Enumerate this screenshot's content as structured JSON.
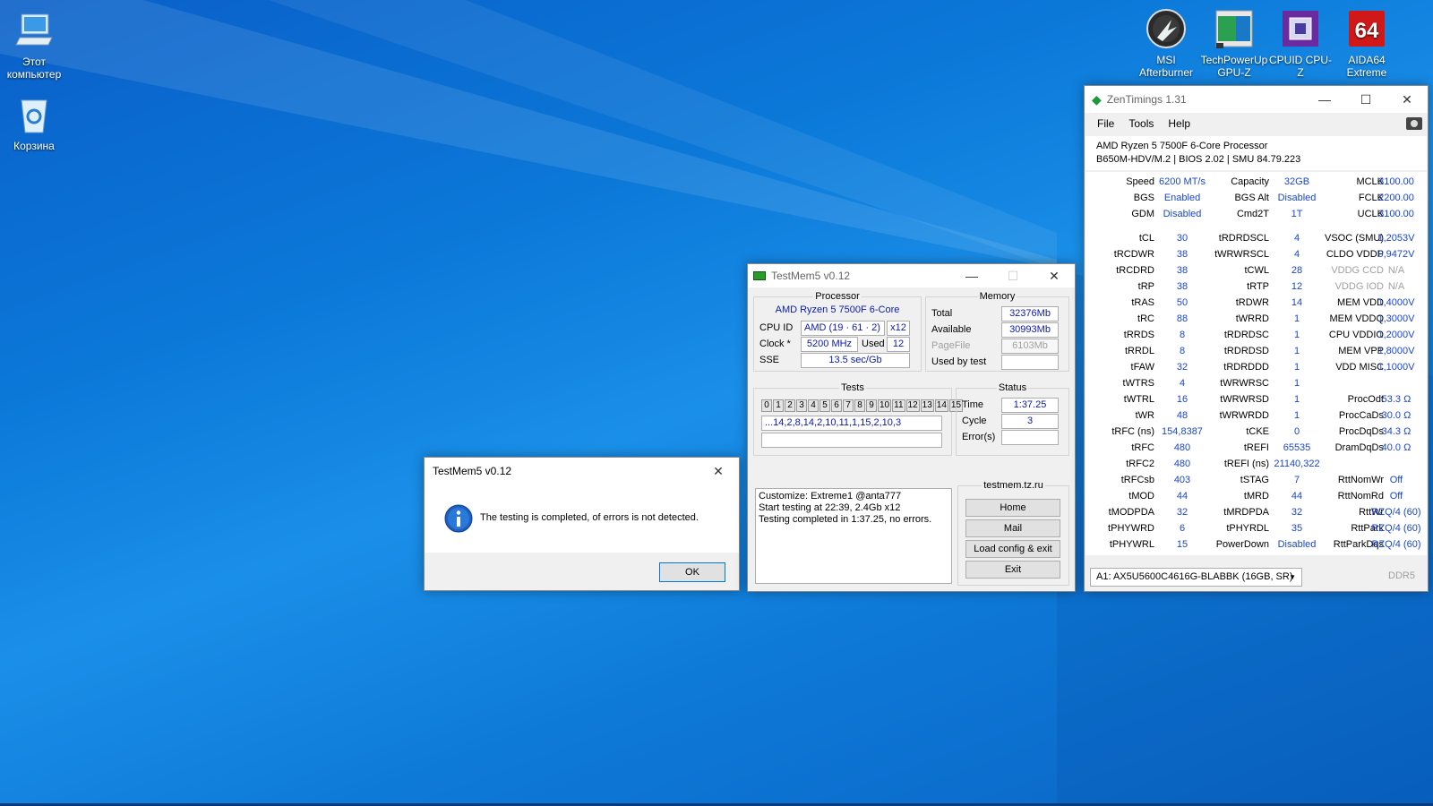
{
  "desktop": {
    "icons": [
      {
        "label": "Этот компьютер",
        "icon": "computer-icon"
      },
      {
        "label": "Корзина",
        "icon": "recycle-bin-icon"
      },
      {
        "label": "MSI Afterburner",
        "icon": "msi-afterburner-icon"
      },
      {
        "label": "TechPowerUp GPU-Z",
        "icon": "gpuz-icon"
      },
      {
        "label": "CPUID CPU-Z",
        "icon": "cpuz-icon"
      },
      {
        "label": "AIDA64 Extreme",
        "icon": "aida64-icon"
      }
    ]
  },
  "dialog": {
    "title": "TestMem5 v0.12",
    "message": "The testing is completed, of errors is not detected.",
    "ok_label": "OK",
    "icon": "info-icon"
  },
  "testmem": {
    "title": "TestMem5 v0.12",
    "processor": {
      "heading": "Processor",
      "name": "AMD Ryzen 5 7500F 6-Core",
      "cpu_id_label": "CPU ID",
      "cpu_id": "AMD  (19 · 61 · 2)",
      "threads": "x12",
      "clock_label": "Clock *",
      "clock": "5200 MHz",
      "used_label": "Used",
      "used": "12",
      "sse_label": "SSE",
      "sse": "13.5 sec/Gb"
    },
    "memory": {
      "heading": "Memory",
      "total_label": "Total",
      "total": "32376Mb",
      "available_label": "Available",
      "available": "30993Mb",
      "pagefile_label": "PageFile",
      "pagefile": "6103Mb",
      "used_by_test_label": "Used by test",
      "used_by_test": ""
    },
    "tests": {
      "heading": "Tests",
      "numbers": [
        "0",
        "1",
        "2",
        "3",
        "4",
        "5",
        "6",
        "7",
        "8",
        "9",
        "10",
        "11",
        "12",
        "13",
        "14",
        "15"
      ],
      "sequence": "...14,2,8,14,2,10,11,1,15,2,10,3",
      "extra": ""
    },
    "status": {
      "heading": "Status",
      "time_label": "Time",
      "time": "1:37.25",
      "cycle_label": "Cycle",
      "cycle": "3",
      "errors_label": "Error(s)",
      "errors": ""
    },
    "log": [
      "Customize: Extreme1 @anta777",
      "Start testing at 22:39, 2.4Gb x12",
      "Testing completed in 1:37.25, no errors."
    ],
    "links": {
      "heading": "testmem.tz.ru",
      "home": "Home",
      "mail": "Mail",
      "load": "Load config & exit",
      "exit": "Exit"
    }
  },
  "zentimings": {
    "title": "ZenTimings 1.31",
    "menu": [
      "File",
      "Tools",
      "Help"
    ],
    "cpu": "AMD Ryzen 5 7500F 6-Core Processor",
    "board": "B650M-HDV/M.2 | BIOS 2.02 | SMU 84.79.223",
    "top": [
      [
        "Speed",
        "6200 MT/s",
        "Capacity",
        "32GB",
        "MCLK",
        "3100.00"
      ],
      [
        "BGS",
        "Enabled",
        "BGS Alt",
        "Disabled",
        "FCLK",
        "2200.00"
      ],
      [
        "GDM",
        "Disabled",
        "Cmd2T",
        "1T",
        "UCLK",
        "3100.00"
      ]
    ],
    "timings": [
      [
        "tCL",
        "30",
        "tRDRDSCL",
        "4",
        "VSOC (SMU)",
        "1,2053V"
      ],
      [
        "tRCDWR",
        "38",
        "tWRWRSCL",
        "4",
        "CLDO VDDP",
        "0,9472V"
      ],
      [
        "tRCDRD",
        "38",
        "tCWL",
        "28",
        "VDDG CCD",
        "N/A"
      ],
      [
        "tRP",
        "38",
        "tRTP",
        "12",
        "VDDG IOD",
        "N/A"
      ],
      [
        "tRAS",
        "50",
        "tRDWR",
        "14",
        "MEM VDD",
        "1,4000V"
      ],
      [
        "tRC",
        "88",
        "tWRRD",
        "1",
        "MEM VDDQ",
        "1,3000V"
      ],
      [
        "tRRDS",
        "8",
        "tRDRDSC",
        "1",
        "CPU VDDIO",
        "1,2000V"
      ],
      [
        "tRRDL",
        "8",
        "tRDRDSD",
        "1",
        "MEM VPP",
        "1,8000V"
      ],
      [
        "tFAW",
        "32",
        "tRDRDDD",
        "1",
        "VDD MISC",
        "1,1000V"
      ],
      [
        "tWTRS",
        "4",
        "tWRWRSC",
        "1",
        "",
        ""
      ],
      [
        "tWTRL",
        "16",
        "tWRWRSD",
        "1",
        "ProcOdt",
        "53.3 Ω"
      ],
      [
        "tWR",
        "48",
        "tWRWRDD",
        "1",
        "ProcCaDs",
        "30.0 Ω"
      ],
      [
        "tRFC (ns)",
        "154,8387",
        "tCKE",
        "0",
        "ProcDqDs",
        "34.3 Ω"
      ],
      [
        "tRFC",
        "480",
        "tREFI",
        "65535",
        "DramDqDs",
        "40.0 Ω"
      ],
      [
        "tRFC2",
        "480",
        "tREFI (ns)",
        "21140,322",
        "",
        ""
      ],
      [
        "tRFCsb",
        "403",
        "tSTAG",
        "7",
        "RttNomWr",
        "Off"
      ],
      [
        "tMOD",
        "44",
        "tMRD",
        "44",
        "RttNomRd",
        "Off"
      ],
      [
        "tMODPDA",
        "32",
        "tMRDPDA",
        "32",
        "RttWr",
        "RZQ/4 (60)"
      ],
      [
        "tPHYWRD",
        "6",
        "tPHYRDL",
        "35",
        "RttPark",
        "RZQ/4 (60)"
      ],
      [
        "tPHYWRL",
        "15",
        "PowerDown",
        "Disabled",
        "RttParkDqs",
        "RZQ/4 (60)"
      ]
    ],
    "module": "A1: AX5U5600C4616G-BLABBK (16GB, SR)",
    "mem_type": "DDR5"
  }
}
